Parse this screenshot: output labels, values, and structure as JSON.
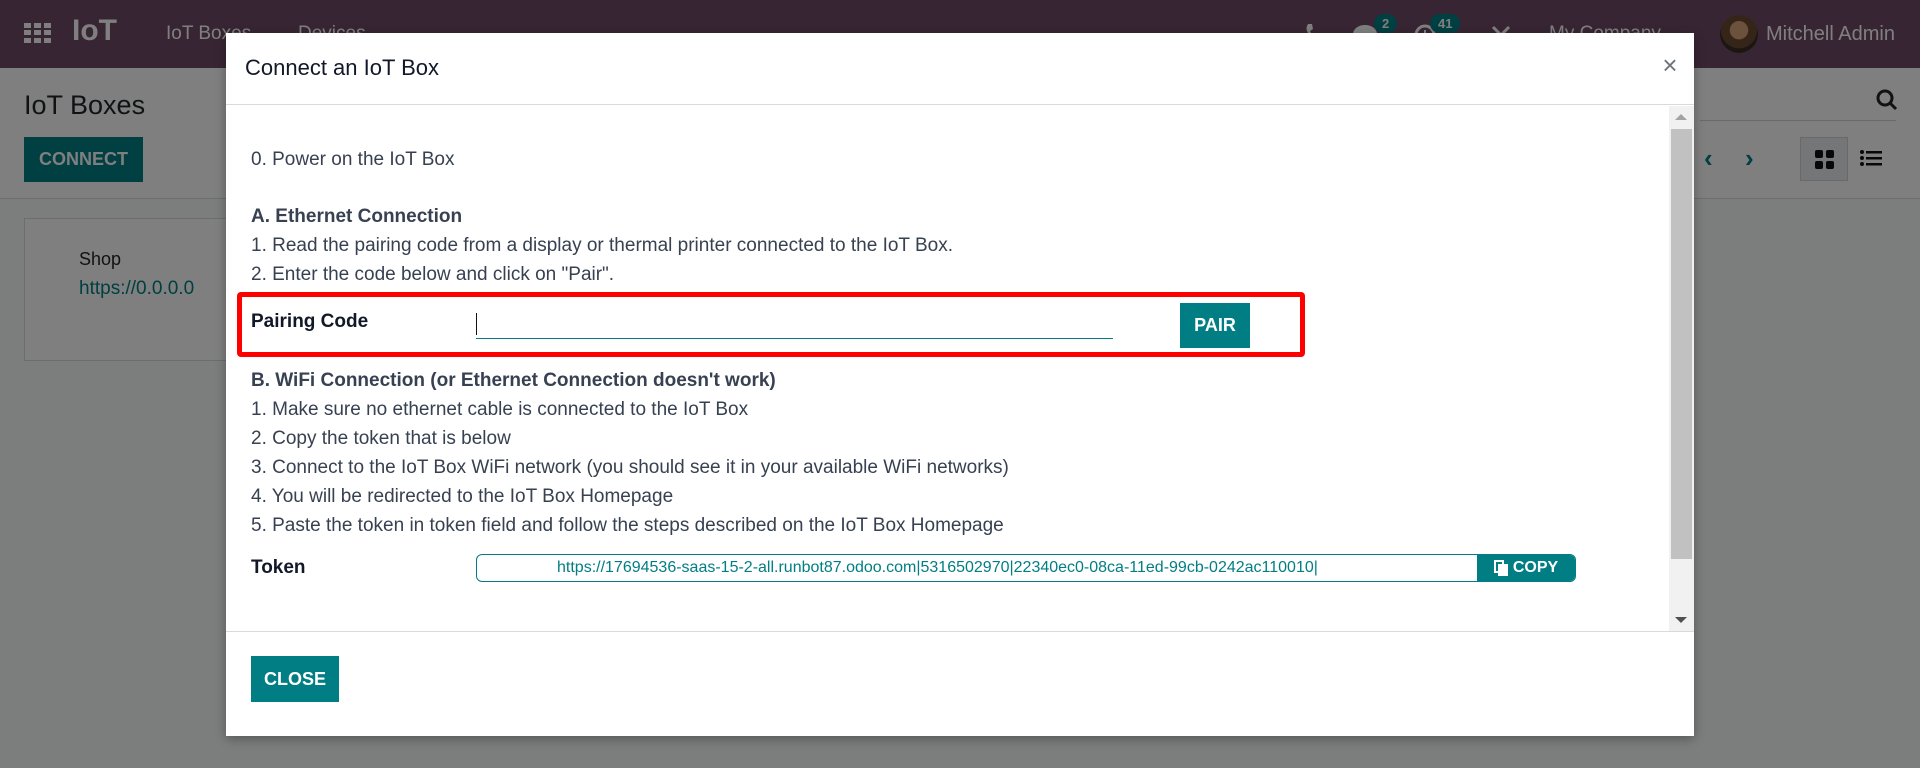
{
  "navbar": {
    "brand": "IoT",
    "menus": [
      "IoT Boxes",
      "Devices"
    ],
    "chat_badge": "2",
    "activity_badge": "41",
    "company": "My Company",
    "user": "Mitchell Admin"
  },
  "control_panel": {
    "title": "IoT Boxes",
    "connect_label": "CONNECT"
  },
  "kanban": {
    "cards": [
      {
        "name": "Shop",
        "url": "https://0.0.0.0"
      }
    ]
  },
  "modal": {
    "title": "Connect an IoT Box",
    "close_symbol": "×",
    "step0": "0. Power on the IoT Box",
    "section_a": {
      "title": "A. Ethernet Connection",
      "steps": [
        "1. Read the pairing code from a display or thermal printer connected to the IoT Box.",
        "2. Enter the code below and click on \"Pair\"."
      ]
    },
    "pairing": {
      "label": "Pairing Code",
      "value": "",
      "placeholder": "",
      "button": "PAIR"
    },
    "section_b": {
      "title": "B. WiFi Connection (or Ethernet Connection doesn't work)",
      "steps": [
        "1. Make sure no ethernet cable is connected to the IoT Box",
        "2. Copy the token that is below",
        "3. Connect to the IoT Box WiFi network (you should see it in your available WiFi networks)",
        "4. You will be redirected to the IoT Box Homepage",
        "5. Paste the token in token field and follow the steps described on the IoT Box Homepage"
      ]
    },
    "token": {
      "label": "Token",
      "value": "https://17694536-saas-15-2-all.runbot87.odoo.com|5316502970|22340ec0-08ca-11ed-99cb-0242ac110010|",
      "copy_label": "COPY"
    },
    "footer_close": "CLOSE"
  },
  "colors": {
    "brand": "#714b67",
    "accent": "#017e84",
    "highlight": "#ff0000"
  }
}
